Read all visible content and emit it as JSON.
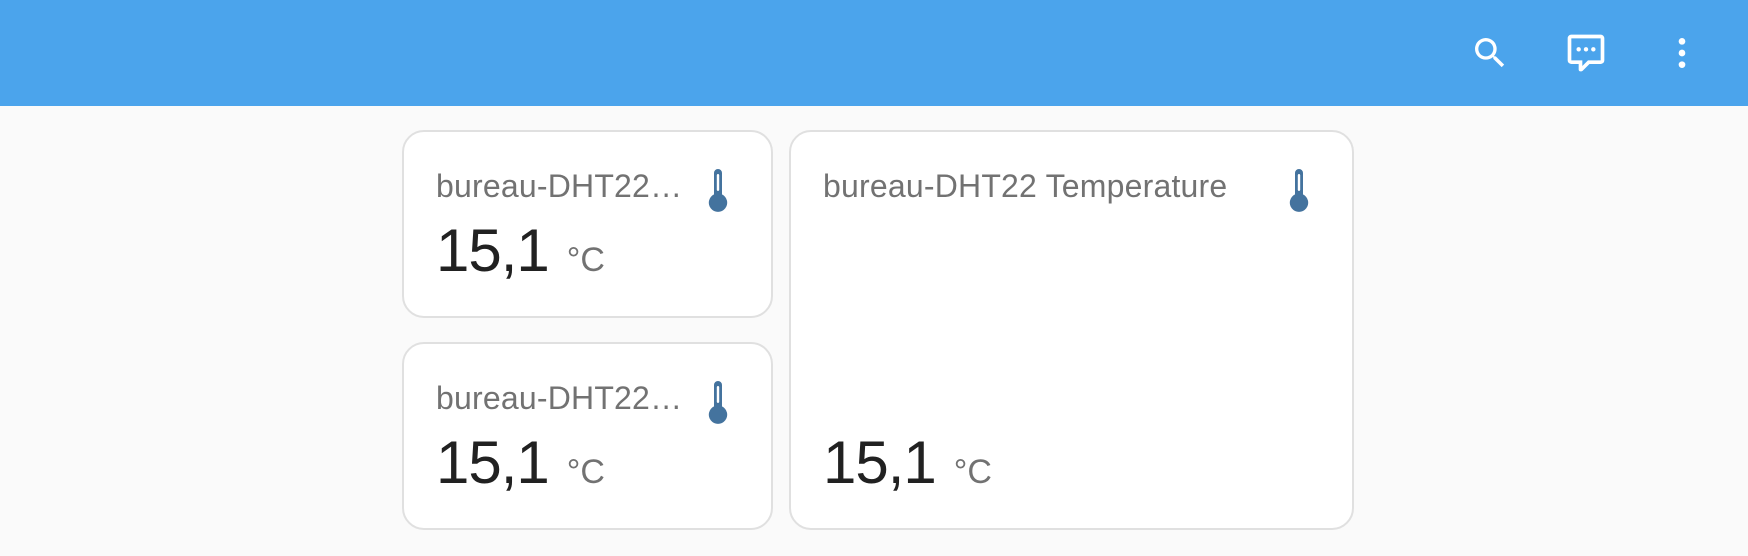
{
  "colors": {
    "header_bg": "#4ba4ec",
    "icon_accent": "#44739e",
    "page_bg": "#fafafa"
  },
  "toolbar": {
    "icons": [
      "search-icon",
      "assist-chat-icon",
      "more-vert-icon"
    ]
  },
  "cards": [
    {
      "name": "bureau-DHT22 ...",
      "value": "15,1",
      "unit": "°C",
      "icon": "thermometer-icon"
    },
    {
      "name": "bureau-DHT22 ...",
      "value": "15,1",
      "unit": "°C",
      "icon": "thermometer-icon"
    },
    {
      "name": "bureau-DHT22 Temperature",
      "value": "15,1",
      "unit": "°C",
      "icon": "thermometer-icon"
    }
  ]
}
